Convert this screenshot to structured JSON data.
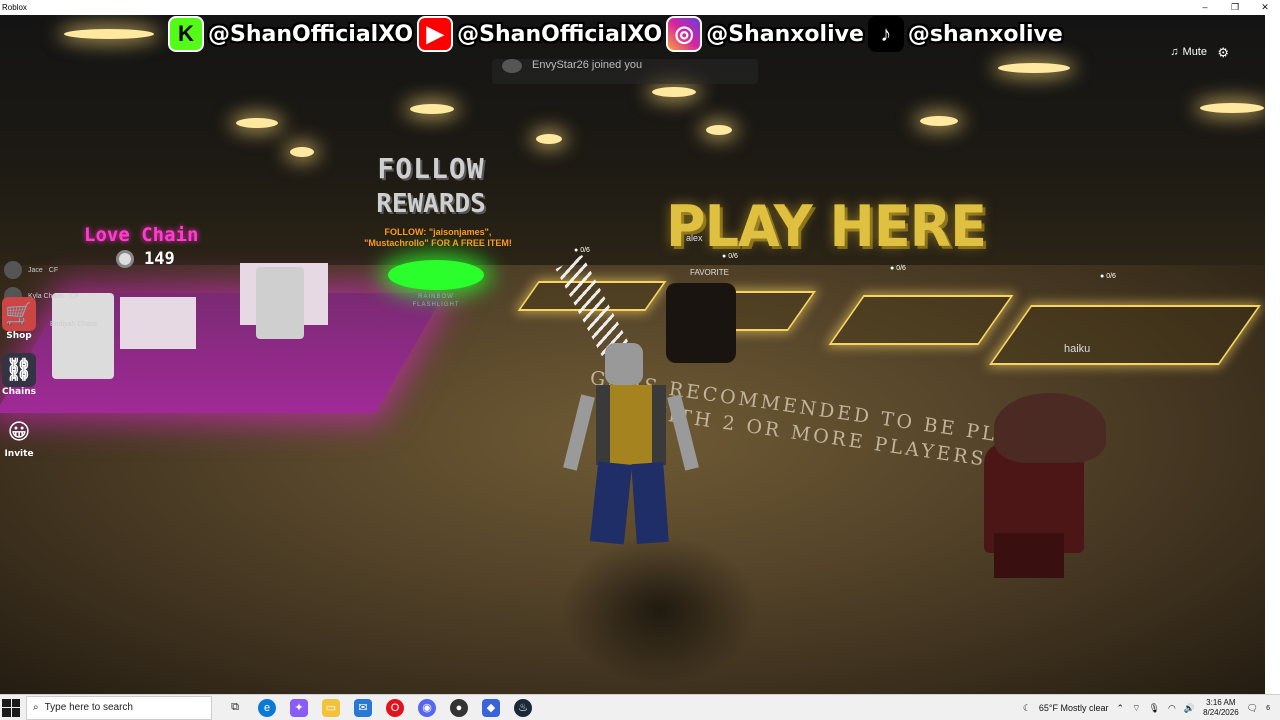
{
  "window": {
    "title": "Roblox",
    "controls": [
      "–",
      "❐",
      "✕"
    ]
  },
  "banner": [
    {
      "platform_icon": "kick-icon",
      "letter": "K",
      "color": "#53fc18",
      "handle": "@ShanOfficialXO"
    },
    {
      "platform_icon": "youtube-icon",
      "letter": "▶",
      "color": "#ff0000",
      "handle": "@ShanOfficialXO"
    },
    {
      "platform_icon": "instagram-icon",
      "letter": "◎",
      "color": "#d6249f",
      "handle": "@Shanxolive"
    },
    {
      "platform_icon": "tiktok-icon",
      "letter": "♪",
      "color": "#000000",
      "handle": "@shanxolive"
    }
  ],
  "toast": {
    "text": "EnvyStar26 joined you"
  },
  "top_right": {
    "mute_label": "Mute"
  },
  "world": {
    "follow_sign": {
      "line1": "FOLLOW",
      "line2": "REWARDS"
    },
    "follow_note": {
      "line1": "FOLLOW: \"jaisonjames\",",
      "line2": "\"Mustachrollo\" FOR A FREE ITEM!"
    },
    "flashlight_label": {
      "line1": "RAINBOW",
      "line2": "FLASHLIGHT"
    },
    "play_here": "PLAY HERE",
    "pad_counts": [
      "0/6",
      "0/6",
      "0/6",
      "0/6"
    ],
    "favorite_label": "FAVORITE",
    "floor_message": {
      "line1": "GA  IS RECOMMENDED TO BE PLA",
      "line2": "WITH 2 OR MORE PLAYERS"
    },
    "nametags": {
      "alex": "alex",
      "haiku": "haiku"
    }
  },
  "hud": {
    "love_chain": "Love Chain",
    "coins": "149",
    "players": [
      {
        "name": "Jace",
        "tag": "CF"
      },
      {
        "name": "Kyla Chaos",
        "tag": "CF"
      },
      {
        "name": "Endiyah Chaos",
        "tag": ""
      }
    ],
    "side_buttons": [
      {
        "label": "Shop",
        "icon": "shop-icon"
      },
      {
        "label": "Chains",
        "icon": "chain-icon"
      },
      {
        "label": "Invite",
        "icon": "invite-icon"
      }
    ]
  },
  "taskbar": {
    "search_placeholder": "Type here to search",
    "weather": "65°F  Mostly clear",
    "time": "3:16 AM",
    "date": "8/24/2026",
    "notifications": "6"
  }
}
